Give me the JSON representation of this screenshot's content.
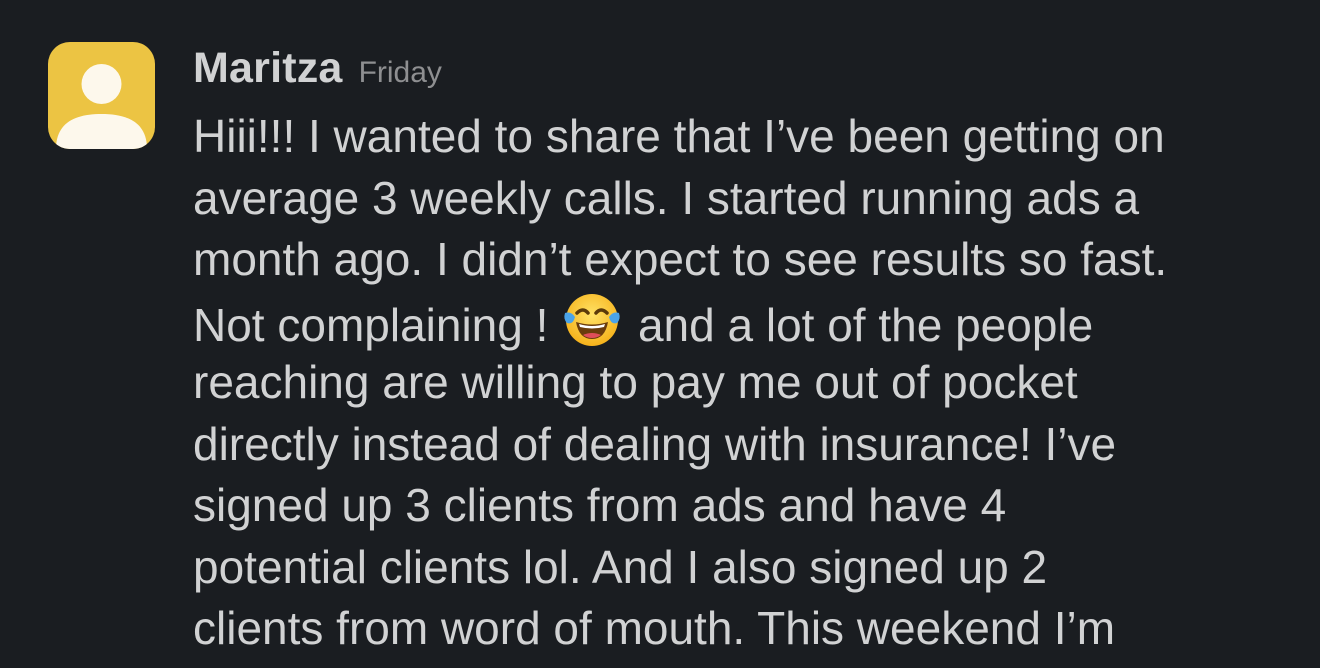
{
  "message": {
    "sender": "Maritza",
    "timestamp": "Friday",
    "lines": [
      "Hiii!!! I wanted to share that I’ve been getting on",
      "average 3 weekly calls. I started running ads a",
      "month ago. I didn’t expect to see results so fast.",
      "Not complaining !",
      "and a lot of the people",
      "reaching are willing to pay me out of pocket",
      "directly instead of dealing with insurance! I’ve",
      "signed up 3 clients from ads and have 4",
      "potential clients lol. And I also signed up 2",
      "clients from word of mouth. This weekend I’m"
    ],
    "emoji": "face-with-tears-of-joy-icon"
  },
  "colors": {
    "background": "#1a1d21",
    "avatar": "#ecc443",
    "text": "#d1d2d3",
    "timestamp": "#8e8f91"
  }
}
